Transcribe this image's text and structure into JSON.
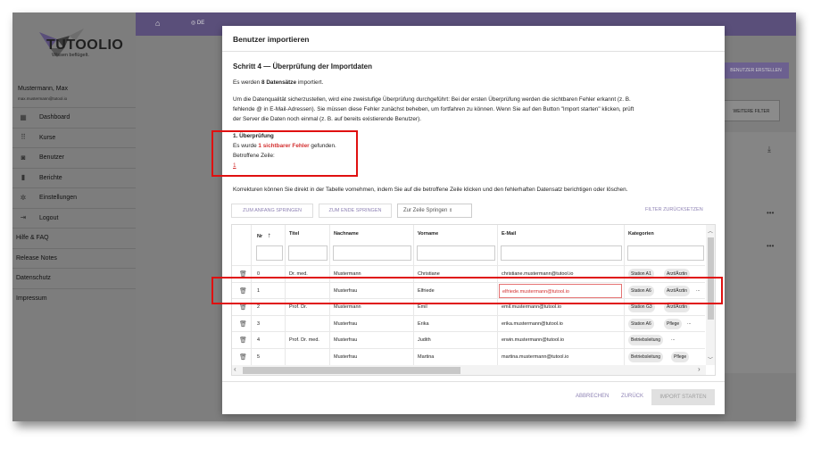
{
  "app": {
    "logo_text": "TUTOOLIO",
    "logo_tagline": "Wissen beflügelt.",
    "user_name": "Mustermann, Max",
    "user_email": "max.mustermann@tutool.io",
    "topbar_lang": "DE",
    "bg_button": "BENUTZER ERSTELLEN",
    "bg_filter": "WEITERE FILTER"
  },
  "sidebar": {
    "items": [
      {
        "label": "Dashboard",
        "icon": "dashboard-icon"
      },
      {
        "label": "Kurse",
        "icon": "grid-icon"
      },
      {
        "label": "Benutzer",
        "icon": "user-icon"
      },
      {
        "label": "Berichte",
        "icon": "chart-icon"
      },
      {
        "label": "Einstellungen",
        "icon": "gear-icon"
      },
      {
        "label": "Logout",
        "icon": "logout-icon"
      }
    ],
    "links": [
      "Hilfe & FAQ",
      "Release Notes",
      "Datenschutz",
      "Impressum"
    ]
  },
  "modal": {
    "title": "Benutzer importieren",
    "step": "Schritt 4 — Überprüfung der Importdaten",
    "imported_prefix": "Es werden ",
    "imported_count": "8 Datensätze",
    "imported_suffix": " importiert.",
    "intro_line1": "Um die Datenqualität sicherzustellen, wird eine zweistufige Überprüfung durchgeführt: Bei der ersten Überprüfung werden die sichtbaren Fehler erkannt (z. B.",
    "intro_line2": "fehlende @ in E-Mail-Adressen). Sie müssen diese Fehler zunächst beheben, um fortfahren zu können. Wenn Sie auf den Button \"Import starten\" klicken, prüft",
    "intro_line3": "der Server die Daten noch einmal (z. B. auf bereits existierende Benutzer).",
    "check_title": "1. Überprüfung",
    "check_prefix": "Es wurde ",
    "check_error": "1 sichtbarer Fehler",
    "check_suffix": " gefunden.",
    "affected_label": "Betroffene Zeile:",
    "affected_row": "1",
    "correction_hint": "Korrekturen können Sie direkt in der Tabelle vornehmen, indem Sie auf die betroffene Zeile klicken und den fehlerhaften Datensatz berichtigen oder löschen.",
    "btn_start": "ZUM ANFANG SPRINGEN",
    "btn_end": "ZUM ENDE SPRINGEN",
    "jump_placeholder": "Zur Zeile Springen",
    "btn_reset_filter": "FILTER ZURÜCKSETZEN",
    "btn_cancel": "ABBRECHEN",
    "btn_back": "ZURÜCK",
    "btn_import": "IMPORT STARTEN"
  },
  "table": {
    "headers": {
      "nr": "Nr",
      "titel": "Titel",
      "nachname": "Nachname",
      "vorname": "Vorname",
      "email": "E-Mail",
      "kategorien": "Kategorien"
    },
    "rows": [
      {
        "nr": "0",
        "titel": "Dr. med.",
        "nachname": "Mustermann",
        "vorname": "Christiane",
        "email": "christiane.mustermann@tutool.io",
        "chips": [
          "Station A1",
          "Arzt/Ärztin"
        ],
        "error": false
      },
      {
        "nr": "1",
        "titel": "",
        "nachname": "Musterfrau",
        "vorname": "Elfriede",
        "email": "elfriede.mustermann@tutool.io",
        "chips": [
          "Station A6",
          "Arzt/Ärztin",
          "..."
        ],
        "error": true
      },
      {
        "nr": "2",
        "titel": "Prof. Dr.",
        "nachname": "Mustermann",
        "vorname": "Emil",
        "email": "emil.mustermann@tutool.io",
        "chips": [
          "Station G3",
          "Arzt/Ärztin"
        ],
        "error": false
      },
      {
        "nr": "3",
        "titel": "",
        "nachname": "Musterfrau",
        "vorname": "Erika",
        "email": "erika.mustermann@tutool.io",
        "chips": [
          "Station A6",
          "Pflege",
          "..."
        ],
        "error": false
      },
      {
        "nr": "4",
        "titel": "Prof. Dr. med.",
        "nachname": "Musterfrau",
        "vorname": "Judith",
        "email": "erwin.mustermann@tutool.io",
        "chips": [
          "Betriebsleitung",
          "..."
        ],
        "error": false
      },
      {
        "nr": "5",
        "titel": "",
        "nachname": "Musterfrau",
        "vorname": "Martina",
        "email": "martina.mustermann@tutool.io",
        "chips": [
          "Betriebsleitung",
          "Pflege"
        ],
        "error": false
      }
    ]
  }
}
